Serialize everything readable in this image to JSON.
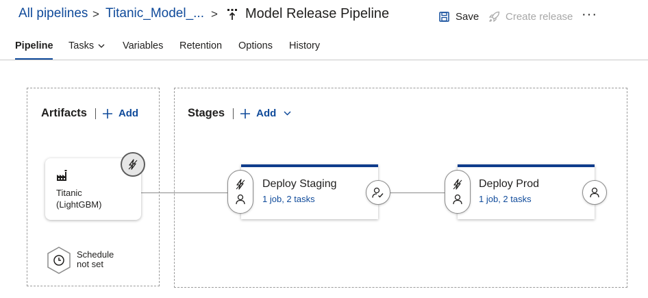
{
  "breadcrumb": {
    "root": "All pipelines",
    "separator": ">",
    "project": "Titanic_Model_...",
    "title": "Model Release Pipeline"
  },
  "actions": {
    "save": "Save",
    "create_release": "Create release",
    "more": "···"
  },
  "tabs": [
    {
      "label": "Pipeline",
      "active": true
    },
    {
      "label": "Tasks",
      "has_dropdown": true
    },
    {
      "label": "Variables"
    },
    {
      "label": "Retention"
    },
    {
      "label": "Options"
    },
    {
      "label": "History"
    }
  ],
  "artifacts": {
    "heading": "Artifacts",
    "add_label": "Add",
    "items": [
      {
        "name_line1": "Titanic",
        "name_line2": "(LightGBM)",
        "icon": "build-icon",
        "trigger_icon": "lightning-icon"
      }
    ],
    "schedule": {
      "line1": "Schedule",
      "line2": "not set",
      "icon": "clock-icon"
    }
  },
  "stages": {
    "heading": "Stages",
    "add_label": "Add",
    "items": [
      {
        "name": "Deploy Staging",
        "summary": "1 job, 2 tasks",
        "pre_icons": [
          "lightning-icon",
          "person-icon"
        ],
        "post_icon": "person-check-icon"
      },
      {
        "name": "Deploy Prod",
        "summary": "1 job, 2 tasks",
        "pre_icons": [
          "lightning-icon",
          "person-icon"
        ],
        "post_icon": "person-icon"
      }
    ]
  },
  "colors": {
    "accent": "#0f4a9a",
    "stage_bar": "#0f3c8c",
    "disabled_text": "#a8a8a8",
    "border_dashed": "#9a9a9a"
  }
}
